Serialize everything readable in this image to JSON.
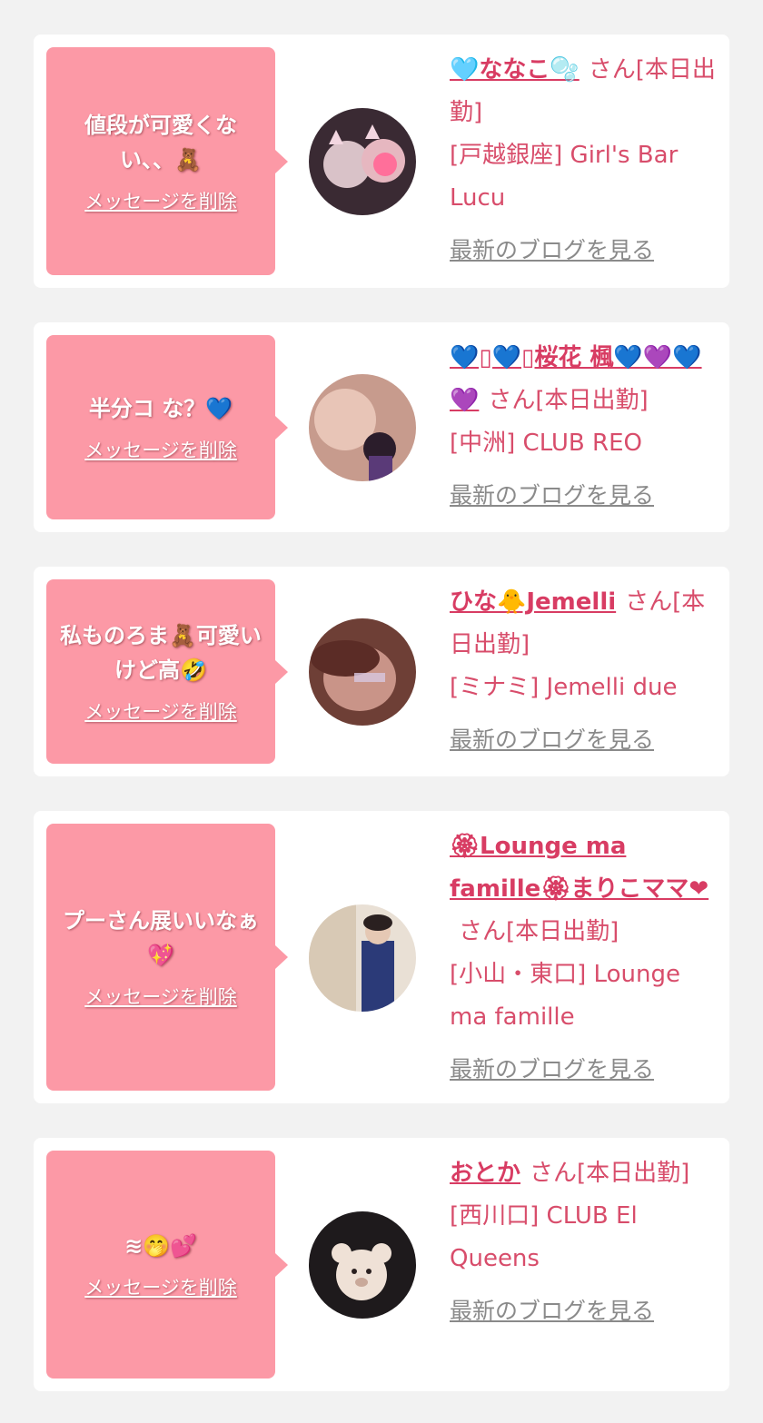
{
  "cards": [
    {
      "message": "値段が可愛くない、、🧸",
      "delete_label": "メッセージを削除",
      "name": "🩵ななこ🫧",
      "honorific": "さん[本日出勤]",
      "shop": "[戸越銀座] Girl's Bar Lucu",
      "blog_label": "最新のブログを見る"
    },
    {
      "message": "半分コ な？💙",
      "delete_label": "メッセージを削除",
      "name": "💙▯💙▯桜花 楓💙💜💙💜",
      "honorific": "さん[本日出勤]",
      "shop": "[中洲] CLUB REO",
      "blog_label": "最新のブログを見る"
    },
    {
      "message": "私ものろま🧸可愛いけど高🤣",
      "delete_label": "メッセージを削除",
      "name": "ひな🐥Jemelli",
      "honorific": "さん[本日出勤]",
      "shop": "[ミナミ] Jemelli due",
      "blog_label": "最新のブログを見る"
    },
    {
      "message": "プーさん展いいなぁ💖",
      "delete_label": "メッセージを削除",
      "name": "🏵Lounge ma famille🏵まりこママ❤",
      "honorific": "さん[本日出勤]",
      "shop": "[小山・東口] Lounge ma famille",
      "blog_label": "最新のブログを見る"
    },
    {
      "message": "≋🤭💕",
      "delete_label": "メッセージを削除",
      "name": "おとか",
      "honorific": "さん[本日出勤]",
      "shop": "[西川口] CLUB El Queens",
      "blog_label": "最新のブログを見る"
    }
  ],
  "colors": {
    "background": "#f2f2f2",
    "bubble": "#fc99a6",
    "accent": "#d83c63",
    "link_gray": "#8a8a8a"
  }
}
